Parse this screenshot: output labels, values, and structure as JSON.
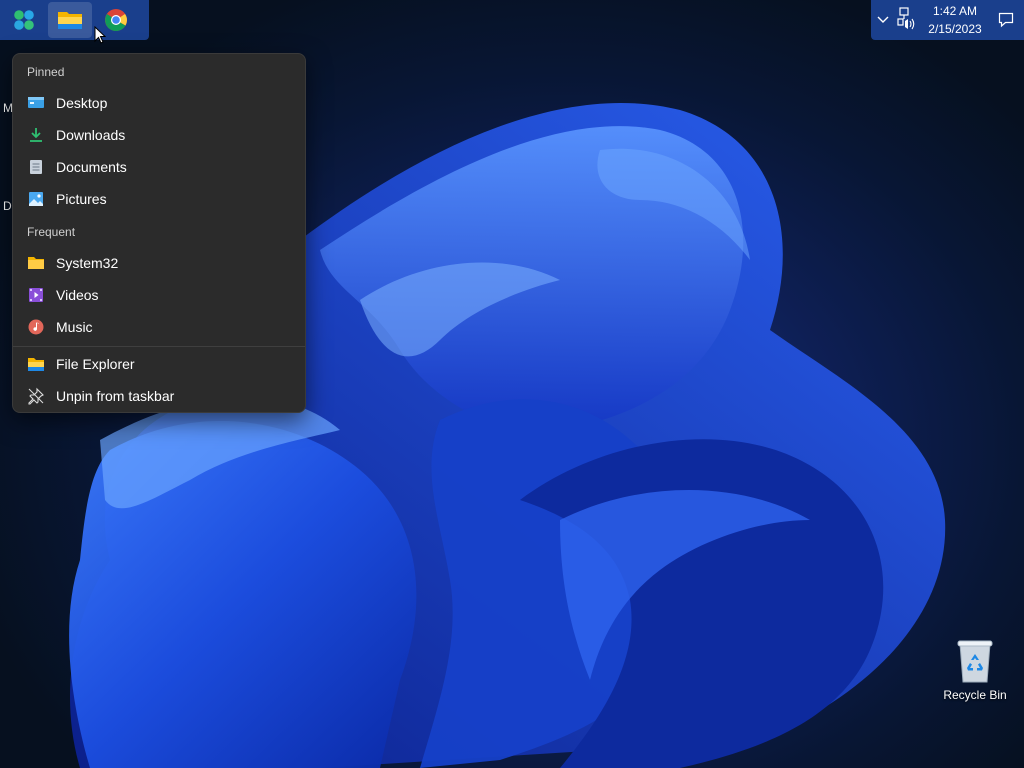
{
  "taskbar": {
    "apps": [
      {
        "name": "start-icon"
      },
      {
        "name": "file-explorer-icon"
      },
      {
        "name": "chrome-icon"
      }
    ]
  },
  "tray": {
    "time": "1:42 AM",
    "date": "2/15/2023"
  },
  "jumplist": {
    "pinned_header": "Pinned",
    "pinned": [
      {
        "label": "Desktop",
        "icon": "desktop-folder-icon"
      },
      {
        "label": "Downloads",
        "icon": "downloads-icon"
      },
      {
        "label": "Documents",
        "icon": "documents-icon"
      },
      {
        "label": "Pictures",
        "icon": "pictures-icon"
      }
    ],
    "frequent_header": "Frequent",
    "frequent": [
      {
        "label": "System32",
        "icon": "folder-icon"
      },
      {
        "label": "Videos",
        "icon": "videos-icon"
      },
      {
        "label": "Music",
        "icon": "music-icon"
      }
    ],
    "actions": [
      {
        "label": "File Explorer",
        "icon": "file-explorer-icon"
      },
      {
        "label": "Unpin from taskbar",
        "icon": "unpin-icon"
      }
    ]
  },
  "desktop": {
    "peek_labels": [
      "M",
      "D"
    ],
    "recycle_bin": {
      "label": "Recycle Bin"
    }
  },
  "colors": {
    "taskbar": "#1a3f8c",
    "menu_bg": "#2b2b2b",
    "accent": "#1f5bd8"
  }
}
